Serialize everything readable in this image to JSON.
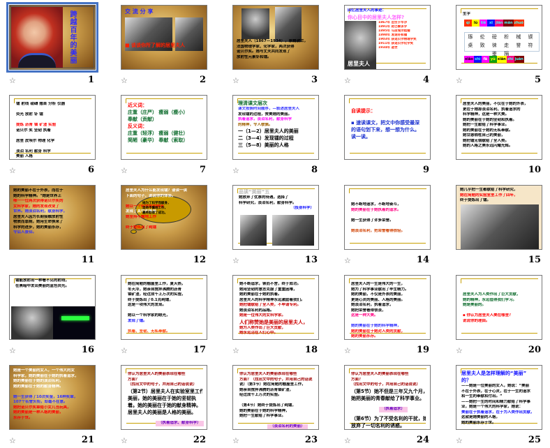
{
  "view": "slide-sorter",
  "selected_slide": 1,
  "colors": {
    "selection": "#4472c4",
    "gold_rule": "#c8a000"
  },
  "star_icon": "transition-icon",
  "slides": [
    {
      "number": "1",
      "starred": true,
      "theme": "parchment",
      "title_vertical": "跨越百年的美丽",
      "lines": []
    },
    {
      "number": "2",
      "starred": true,
      "theme": "parchment",
      "lines": [
        {
          "text": "交  流  分  享",
          "color": "#2a2aff",
          "cls": "title"
        },
        {
          "text": "",
          "color": "#000"
        },
        {
          "text": "",
          "color": "#000"
        },
        {
          "text": "",
          "color": "#000"
        },
        {
          "text": "",
          "color": "#000"
        },
        {
          "text": "",
          "color": "#000"
        },
        {
          "text": "■ 谈谈你所了解的居里夫人",
          "color": "#ff2000",
          "cls": "big"
        }
      ]
    },
    {
      "number": "3",
      "starred": true,
      "theme": "parchment",
      "lines": [
        {
          "text": "",
          "color": "#000"
        },
        {
          "text": "",
          "color": "#000"
        },
        {
          "text": "",
          "color": "#000"
        },
        {
          "text": "",
          "color": "#000"
        },
        {
          "text": "",
          "color": "#000"
        },
        {
          "text": "",
          "color": "#000"
        },
        {
          "text": "居里夫人（1867—1934），原籍波兰，",
          "color": "#000"
        },
        {
          "text": "法国物理学家、化学家，两次获得",
          "color": "#000"
        },
        {
          "text": "诺贝尔奖。她与丈夫共同发现了",
          "color": "#000"
        },
        {
          "text": "放射性元素钋和镭。",
          "color": "#000"
        }
      ]
    },
    {
      "number": "4",
      "starred": true,
      "theme": "white",
      "lines": [
        {
          "text": "回忆居里夫人的事迹：",
          "color": "#1010ff"
        },
        {
          "text": "你心目中的居里夫人怎样?",
          "color": "#ff66ff",
          "cls": "big"
        },
        {
          "text": "1867年 出生于华沙",
          "color": "#ff2000"
        },
        {
          "text": "1891年 赴巴黎求学",
          "color": "#ff2000"
        },
        {
          "text": "1895年 与皮埃尔结婚",
          "color": "#ff2000"
        },
        {
          "text": "1898年 发现钋和镭",
          "color": "#ff2000"
        },
        {
          "text": "1903年 获诺贝尔物理学奖",
          "color": "#ff2000"
        },
        {
          "text": "1911年 获诺贝尔化学奖",
          "color": "#ff2000"
        },
        {
          "text": "1934年 逝世",
          "color": "#ff2000"
        }
      ],
      "caption": "居里夫人"
    },
    {
      "number": "5",
      "starred": true,
      "theme": "white",
      "lines": [
        {
          "text": "生字",
          "color": "#000"
        }
      ],
      "pinyin_top": [
        "qì",
        "lù",
        "tiē",
        "xī",
        "jiān",
        "mǎn",
        "zhuó"
      ],
      "pinyin_bottom": [
        "xiāo",
        "shì",
        "fā",
        "yù",
        "xiān",
        "zhì",
        "juàn"
      ],
      "chars": "琢 伦 磅 析 械 锲 桌 致 徕 走 誉 符 鉴 捐"
    },
    {
      "number": "6",
      "starred": true,
      "theme": "white",
      "lines": [
        {
          "text": "镭 射线 磅礴 翘首 分析 仪器",
          "color": "#000"
        },
        {
          "text": "",
          "color": "#000"
        },
        {
          "text": "荧光 放射 钋 镭",
          "color": "#000"
        },
        {
          "text": "",
          "color": "#000"
        },
        {
          "text": "提炼 沥青 铀 矿渣 实验",
          "color": "#ff0000"
        },
        {
          "text": "诺贝尔 奖 坚韧 执着",
          "color": "#000"
        },
        {
          "text": "",
          "color": "#000"
        },
        {
          "text": "居里 皮埃尔 物理 化学",
          "color": "#000"
        },
        {
          "text": "",
          "color": "#000"
        },
        {
          "text": "淡泊 名利 献身 科学",
          "color": "#000"
        },
        {
          "text": "美丽 人格",
          "color": "#000"
        }
      ]
    },
    {
      "number": "7",
      "starred": true,
      "theme": "white",
      "lines": [
        {
          "text": "近义词：",
          "color": "#ff0000",
          "cls": "big"
        },
        {
          "text": "庄重（庄严） 瘦弱（瘦小）",
          "color": "#0a6a2a",
          "cls": "big"
        },
        {
          "text": "奉献（贡献）",
          "color": "#0a6a2a",
          "cls": "big"
        },
        {
          "text": "反义词：",
          "color": "#ff0000",
          "cls": "big"
        },
        {
          "text": "庄重（轻浮） 瘦弱（健壮）",
          "color": "#0a6a2a",
          "cls": "big"
        },
        {
          "text": "简陋（豪华） 奉献（索取）",
          "color": "#0a6a2a",
          "cls": "big"
        }
      ]
    },
    {
      "number": "8",
      "starred": true,
      "theme": "white",
      "lines": [
        {
          "text": "理清课文层次",
          "color": "#0a6a2a",
          "cls": "big"
        },
        {
          "text": "课文按照时间顺序，—叙述居里夫人",
          "color": "#3030ff"
        },
        {
          "text": "发现镭的过程，赞美她的美丽。",
          "color": "#000"
        },
        {
          "text": "执着追求，淡泊名利，献身科学",
          "color": "#ff00ff"
        },
        {
          "text": "的精神，令人敬佩。",
          "color": "#a06000"
        },
        {
          "text": "一（1—2）居里夫人的美丽",
          "color": "#000",
          "cls": "big"
        },
        {
          "text": "二（3—4）发现镭的过程",
          "color": "#000",
          "cls": "big"
        },
        {
          "text": "三（5—8）美丽的人格",
          "color": "#000",
          "cls": "big"
        }
      ]
    },
    {
      "number": "9",
      "starred": false,
      "theme": "white",
      "lines": [
        {
          "text": "",
          "color": "#000"
        },
        {
          "text": "自读提示：",
          "color": "#ff0000",
          "cls": "big"
        },
        {
          "text": "",
          "color": "#000"
        },
        {
          "text": "▪ 速读课文，把文中你感受最深",
          "color": "#1a30d0",
          "cls": "big"
        },
        {
          "text": "  的语句划下来，想一想为什么。",
          "color": "#1a30d0",
          "cls": "big"
        },
        {
          "text": "  读一读。",
          "color": "#1a30d0",
          "cls": "big"
        }
      ]
    },
    {
      "number": "10",
      "starred": false,
      "theme": "white",
      "lines": [
        {
          "text": "居里夫人的美丽，不仅在于她的外表，",
          "color": "#000"
        },
        {
          "text": "更在于她那淡泊名利、执着追求的",
          "color": "#000"
        },
        {
          "text": "科学精神，这是一种大美。",
          "color": "#000"
        },
        {
          "text": "她的美丽在于她的坚韧和执着。",
          "color": "#000"
        },
        {
          "text": "她把一生献给了科学事业。",
          "color": "#000"
        },
        {
          "text": "她的美丽在于她的无私奉献。",
          "color": "#000"
        },
        {
          "text": "她甘愿牺牲自己的美丽，",
          "color": "#000"
        },
        {
          "text": "她把镭无偿献给了全人类。",
          "color": "#000"
        },
        {
          "text": "她的人格之美永远闪耀光辉。",
          "color": "#000"
        }
      ]
    },
    {
      "number": "11",
      "starred": false,
      "theme": "parchment",
      "lines": [
        {
          "text": "她的美丽不在于外表，而在于",
          "color": "#000"
        },
        {
          "text": "她的科学精神。\"她是世界上",
          "color": "#000"
        },
        {
          "text": "唯一一位两次获得诺贝尔奖的",
          "color": "#ff0000"
        },
        {
          "text": "女科学家，她的发现改变了",
          "color": "#ff0000"
        },
        {
          "text": "世界。她淡泊名利，献身科学，",
          "color": "#3030ff"
        },
        {
          "text": "居里夫人因为长期接触放射性",
          "color": "#000"
        },
        {
          "text": "物质而患病，她用生命换来了",
          "color": "#000"
        },
        {
          "text": "科学的进步，她的美丽永存，",
          "color": "#000"
        },
        {
          "text": "令后人景仰。",
          "color": "#3030ff"
        }
      ]
    },
    {
      "number": "12",
      "starred": false,
      "theme": "parchment",
      "lines": [
        {
          "text": "居里夫人为什么能发现镭？请读一读",
          "color": "#fff"
        },
        {
          "text": "下面的句子，说说你的体会。",
          "color": "#fff"
        },
        {
          "text": "",
          "color": "#fff"
        },
        {
          "text": "她以一个科学家的眼光",
          "color": "#ff0000"
        },
        {
          "text": "发现了其中的奥秘",
          "color": "#fff"
        },
        {
          "text": "她坚持不懈地工作",
          "color": "#ff0000"
        },
        {
          "text": "",
          "color": "#fff"
        },
        {
          "text": "终于提炼出了纯镭",
          "color": "#ff0000"
        }
      ],
      "bubble": [
        "她为了科学而献身，",
        "坚持不懈地工作，",
        "最终取得了成功。"
      ]
    },
    {
      "number": "13",
      "starred": true,
      "theme": "white",
      "lines": [
        {
          "text": "品读“美丽”五",
          "color": "#bbbbbb",
          "cls": "big"
        },
        {
          "text": "她放弃了优厚的待遇，选择了",
          "color": "#000"
        },
        {
          "text": "科学研究，淡泊名利，献身科学。",
          "color": "#000"
        },
        {
          "text": "（投身科学）",
          "color": "#1010ff"
        }
      ]
    },
    {
      "number": "14",
      "starred": true,
      "theme": "white",
      "lines": [
        {
          "text": "",
          "color": "#000"
        },
        {
          "text": "",
          "color": "#000"
        },
        {
          "text": "她不断地追求，不断地奋斗，",
          "color": "#000"
        },
        {
          "text": "  她的美丽在于她执着的追求。",
          "color": "#ff0080"
        },
        {
          "text": "",
          "color": "#000"
        },
        {
          "text": " 她一生获得了许多荣誉。",
          "color": "#000"
        },
        {
          "text": "",
          "color": "#000"
        },
        {
          "text": "  她淡泊名利，把荣誉看得很轻。",
          "color": "#d04000"
        }
      ]
    },
    {
      "number": "15",
      "starred": false,
      "theme": "cream",
      "lines": [
        {
          "text": "她几乎把一生都献给了科学研究，",
          "color": "#000"
        },
        {
          "text": "她在简陋的实验室里工作了四年，",
          "color": "#ff0000"
        },
        {
          "text": "终于提炼出了镭。",
          "color": "#000"
        }
      ]
    },
    {
      "number": "16",
      "starred": true,
      "theme": "white",
      "lines": [
        {
          "text": "    镭能放射出一种看不见的射线，",
          "color": "#000"
        },
        {
          "text": "在黑暗中发出美丽的蓝色荧光。",
          "color": "#000"
        }
      ]
    },
    {
      "number": "17",
      "starred": true,
      "theme": "white",
      "lines": [
        {
          "text": "她在简陋的棚屋里工作，夏天热，",
          "color": "#000"
        },
        {
          "text": "冬天冷，她亲自搅拌沸腾的沥青",
          "color": "#000"
        },
        {
          "text": "铀矿渣，经过成千上万次的实验，",
          "color": "#000"
        },
        {
          "text": "终于提炼出了0.1克纯镭，",
          "color": "#000"
        },
        {
          "text": "这是一项伟大的发现。",
          "color": "#000"
        },
        {
          "text": "",
          "color": "#000"
        },
        {
          "text": "她以一个科学家的眼光，",
          "color": "#000"
        },
        {
          "text": "发现了镭。",
          "color": "#1010ff"
        },
        {
          "text": "",
          "color": "#000"
        },
        {
          "text": "执着、坚韧、无私奉献。",
          "color": "#ff4000"
        }
      ]
    },
    {
      "number": "18",
      "starred": true,
      "theme": "white",
      "lines": [
        {
          "text": "她不断追求，锲而不舍，终于成功。",
          "color": "#000"
        },
        {
          "text": "她用坚韧的意志克服了重重困难，",
          "color": "#000"
        },
        {
          "text": "她的美丽在于她的执着。",
          "color": "#000"
        },
        {
          "text": "居里夫人的科学精神永远激励着我们。",
          "color": "#000"
        },
        {
          "text": "  她把镭献给了全人类，不申请专利。",
          "color": "#cc0000"
        },
        {
          "text": "她淡泊名利的品格。",
          "color": "#000"
        },
        {
          "text": "  她是一位伟大的女科学家。",
          "color": "#cc0000"
        },
        {
          "text": "  人们称赞她是美丽的居里夫人，",
          "color": "#cc0000",
          "cls": "big"
        },
        {
          "text": "她为人类作出了巨大贡献，",
          "color": "#cc0000"
        },
        {
          "text": "她永远活在人们心中。",
          "color": "#cc0000"
        }
      ]
    },
    {
      "number": "19",
      "starred": true,
      "theme": "white",
      "lines": [
        {
          "text": "居里夫人的一生是伟大的一生，",
          "color": "#000"
        },
        {
          "text": "她为了科学事业献出了毕生精力。",
          "color": "#000"
        },
        {
          "text": "她的美丽，不仅是外表的美丽，",
          "color": "#000"
        },
        {
          "text": "更是心灵的美丽、人格的美丽。",
          "color": "#000"
        },
        {
          "text": "她淡泊名利，执着追求，",
          "color": "#000"
        },
        {
          "text": "她把荣誉看得很淡，",
          "color": "#000"
        },
        {
          "text": "这是一种大美。",
          "color": "#ff0080"
        },
        {
          "text": "",
          "color": "#000"
        },
        {
          "text": "她的美丽在于她的科学精神，",
          "color": "#3030ff"
        },
        {
          "text": "她的美丽在于她对人类的贡献，",
          "color": "#ff0000"
        },
        {
          "text": "她的美丽永存。",
          "color": "#ff0000"
        }
      ]
    },
    {
      "number": "20",
      "starred": true,
      "theme": "white",
      "lines": [
        {
          "text": "",
          "color": "#000"
        },
        {
          "text": "",
          "color": "#000"
        },
        {
          "text": "    居里夫人为人类作出了巨大贡献，",
          "color": "#0a6a2a"
        },
        {
          "text": "她的精神，永远值得我们学习。",
          "color": "#0a6a2a"
        },
        {
          "text": "她是美丽的。",
          "color": "#0a6a2a"
        },
        {
          "text": "",
          "color": "#000"
        },
        {
          "text": "▪ 你认为居里夫人美在哪里？",
          "color": "#ff0000"
        },
        {
          "text": "  说说你的理由。",
          "color": "#ff0000"
        }
      ]
    },
    {
      "number": "21",
      "starred": true,
      "theme": "parchment",
      "lines": [
        {
          "text": "    她是一个美丽的女人，一个伟大的女",
          "color": "#fff"
        },
        {
          "text": "科学家，她的美丽在于她的执着追求，",
          "color": "#fff"
        },
        {
          "text": "她的美丽在于她的淡泊名利，",
          "color": "#fff"
        },
        {
          "text": "她的美丽在于她的献身精神。",
          "color": "#fff"
        },
        {
          "text": "",
          "color": "#fff"
        },
        {
          "text": "    她一生获得了10次奖金，16种奖章，",
          "color": "#3030ff"
        },
        {
          "text": "107个名誉头衔，却毫不在意。",
          "color": "#3030ff"
        },
        {
          "text": "她把诺贝尔奖章给小女儿当玩具，",
          "color": "#ff0000"
        },
        {
          "text": "她的美丽是一种人格的美丽，",
          "color": "#ff0000"
        },
        {
          "text": "永存于世。",
          "color": "#ff0000"
        }
      ]
    },
    {
      "number": "22",
      "starred": true,
      "theme": "white",
      "lines": [
        {
          "text": "你认为居里夫人的美丽表现在哪些",
          "color": "#a00000"
        },
        {
          "text": "方面？",
          "color": "#a00000"
        },
        {
          "text": "（找出文中的句子，并用自己的话说说）",
          "color": "#a00000"
        },
        {
          "text": "  （第2节）居里夫人在实验室里工作的",
          "color": "#000",
          "cls": "big"
        },
        {
          "text": "美丽，她的美丽在于她的坚韧执",
          "color": "#000",
          "cls": "big"
        },
        {
          "text": "着。她的美丽在于她的献身精神。",
          "color": "#000",
          "cls": "big"
        },
        {
          "text": "居里夫人的美丽是人格的美丽。",
          "color": "#000",
          "cls": "big"
        },
        {
          "text": "（执着追求、献身科学）",
          "color": "#6a00c0",
          "cls": "tag"
        }
      ]
    },
    {
      "number": "23",
      "starred": true,
      "theme": "white",
      "lines": [
        {
          "text": "你认为居里夫人的美丽表现在哪些",
          "color": "#a00000"
        },
        {
          "text": "方面？（找出文中的句子，并用自己的话说",
          "color": "#a00000"
        },
        {
          "text": "说）（第3节）她在简陋的棚屋里工作，",
          "color": "#000"
        },
        {
          "text": "她亲自搅拌沸腾的沥青铀矿渣，",
          "color": "#000"
        },
        {
          "text": "经过成千上万次的实验。",
          "color": "#000"
        },
        {
          "text": "",
          "color": "#000"
        },
        {
          "text": "  （第4节）她终于提炼出了纯镭，",
          "color": "#000"
        },
        {
          "text": "她的美丽在于她的科学精神，",
          "color": "#000"
        },
        {
          "text": "她把一生献给了科学事业。",
          "color": "#000"
        },
        {
          "text": "（淡泊名利的美丽）",
          "color": "#6a00c0",
          "cls": "tag"
        }
      ]
    },
    {
      "number": "24",
      "starred": true,
      "theme": "white",
      "lines": [
        {
          "text": "你认为居里夫人的美丽表现在哪些",
          "color": "#a00000"
        },
        {
          "text": "方面？",
          "color": "#a00000"
        },
        {
          "text": "（找出文中的句子，并用自己的话说说）",
          "color": "#a00000"
        },
        {
          "text": "（第5节）她不但是三年又九个月，",
          "color": "#000",
          "cls": "big"
        },
        {
          "text": "她把美丽的青春献给了科学事业。",
          "color": "#000",
          "cls": "big"
        },
        {
          "text": "（执着追求）",
          "color": "#6a00c0",
          "cls": "tag"
        },
        {
          "text": "（第6节）为了不受名利的干扰，她却",
          "color": "#000",
          "cls": "big"
        },
        {
          "text": "放弃了一切名利的诱惑。",
          "color": "#000",
          "cls": "big"
        },
        {
          "text": "（淡泊名利）",
          "color": "#6a00c0",
          "cls": "tag"
        }
      ]
    },
    {
      "number": "25",
      "starred": true,
      "theme": "white",
      "lines": [
        {
          "text": "居里夫人是怎样理解的“美丽”",
          "color": "#1010ff",
          "cls": "big"
        },
        {
          "text": "的？",
          "color": "#1010ff",
          "cls": "big"
        },
        {
          "text": "——她是一位美丽的女人，她说：“美丽",
          "color": "#000"
        },
        {
          "text": "不在于外表，在于心灵，在于一生的追求",
          "color": "#000"
        },
        {
          "text": "和一生的奉献和付出。”",
          "color": "#000"
        },
        {
          "text": "——她把一生的时间和精力献给了科学事",
          "color": "#000"
        },
        {
          "text": "业，她是一个伟大的科学家，她说：",
          "color": "#000"
        },
        {
          "text": "美丽在于执着追求，在于为人类作出贡献，",
          "color": "#1010ff"
        },
        {
          "text": "这就是她美丽的人格，",
          "color": "#000"
        },
        {
          "text": "她的美丽永存于世。",
          "color": "#000"
        }
      ]
    }
  ]
}
